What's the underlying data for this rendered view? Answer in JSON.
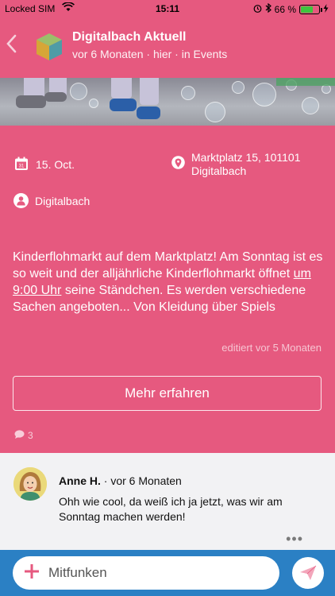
{
  "status": {
    "carrier": "Locked SIM",
    "time": "15:11",
    "battery": "66 %",
    "battery_level": 0.66
  },
  "header": {
    "title": "Digitalbach Aktuell",
    "subtitle": "vor 6 Monaten · hier · in Events"
  },
  "event": {
    "date": "15. Oct.",
    "location_line1": "Marktplatz 15, 101101",
    "location_line2": "Digitalbach",
    "organizer": "Digitalbach",
    "desc_before": "Kinderflohmarkt auf dem Marktplatz! Am Sonntag ist es so weit und der alljährliche Kinderflohmarkt öffnet ",
    "desc_link": "um 9:00 Uhr",
    "desc_after": " seine Ständchen. Es werden verschiedene Sachen angeboten... Von Kleidung über Spiels",
    "edited": "editiert vor 5 Monaten",
    "more_button": "Mehr erfahren",
    "comment_count": "3"
  },
  "comment": {
    "author": "Anne H.",
    "time": "· vor 6 Monaten",
    "text": "Ohh wie cool, da weiß ich ja jetzt, was wir am Sonntag machen werden!",
    "more": "•••"
  },
  "compose": {
    "placeholder": "Mitfunken"
  },
  "colors": {
    "accent": "#e6597f",
    "bottom_bar": "#2b80c4",
    "comment_bg": "#f2f2f4"
  },
  "icons": [
    "wifi-icon",
    "bluetooth-icon",
    "battery-icon",
    "back-chevron-icon",
    "app-cube-icon",
    "calendar-icon",
    "location-pin-icon",
    "person-icon",
    "comment-bubble-icon",
    "plus-icon",
    "send-icon"
  ]
}
